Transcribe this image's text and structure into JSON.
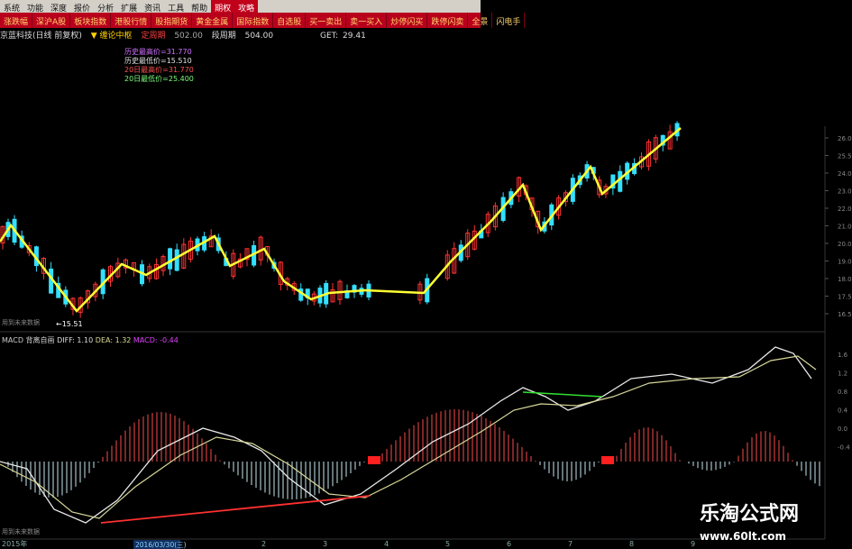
{
  "menu": [
    "系统",
    "功能",
    "深度",
    "报价",
    "分析",
    "扩展",
    "资讯",
    "工具",
    "帮助",
    "期权",
    "攻略"
  ],
  "menu_highlight": [
    9,
    10
  ],
  "tabs": [
    "涨跌幅",
    "深沪A股",
    "板块指数",
    "港股行情",
    "股指期货",
    "黄金金属",
    "国际指数",
    "自选股",
    "买一卖出",
    "卖一买入",
    "炒停闪买",
    "跌停闪卖",
    "全景",
    "闪电手"
  ],
  "info": {
    "stock": "京蓝科技(日线 前复权)",
    "tag": "▼ 缠论中枢",
    "abs_label": "定周期",
    "abs_value": "502.00",
    "seg_label": "段周期",
    "seg_value": "504.00",
    "get_label": "GET:",
    "get_value": "29.41"
  },
  "stats": [
    {
      "text": "历史最高价=31.770",
      "color": "#d070ff"
    },
    {
      "text": "历史最低价=15.510",
      "color": "#e0e0e0"
    },
    {
      "text": "20日最高价=31.770",
      "color": "#ff5050"
    },
    {
      "text": "20日最低价=25.400",
      "color": "#7cff7c"
    }
  ],
  "indicator": {
    "name": "MACD 背离自画",
    "diff_label": "DIFF: 1.10",
    "dea_label": "DEA: 1.32",
    "macd_label": "MACD: -0.44"
  },
  "annotations": {
    "low_price": "15.51",
    "future_data_top": "用到未来数据",
    "future_data_bottom": "用到未来数据",
    "year": "2015年",
    "date_marker": "2016/03/30(三)"
  },
  "price_axis": [
    "26.0",
    "25.5",
    "24.0",
    "23.0",
    "22.0",
    "21.0",
    "20.0",
    "19.0",
    "18.0",
    "17.5",
    "16.5"
  ],
  "macd_axis": [
    "1.6",
    "1.2",
    "0.8",
    "0.4",
    "0.0",
    "-0.4"
  ],
  "x_axis": [
    "2",
    "3",
    "4",
    "5",
    "6",
    "7",
    "8",
    "9"
  ],
  "colors": {
    "up": "#ff3333",
    "down": "#33e0ff",
    "zigzag": "#ffff33",
    "diff": "#e8e8e8",
    "dea": "#d8d89a"
  },
  "watermark": {
    "title": "乐淘公式网",
    "url": "www.60lt.com"
  }
}
